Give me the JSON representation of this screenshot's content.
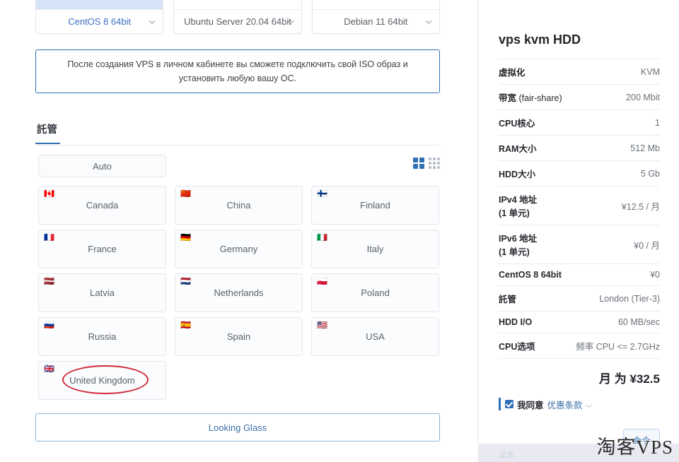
{
  "os_cards": [
    {
      "name": "CentOS 8 64bit",
      "selected": true,
      "caret": "chevron-down-icon"
    },
    {
      "name": "Ubuntu Server 20.04 64bit",
      "selected": false,
      "caret": "chevron-down-icon"
    },
    {
      "name": "Debian 11 64bit",
      "selected": false,
      "caret": "chevron-down-icon"
    }
  ],
  "info_banner": {
    "text": "После создания VPS в личном кабинете вы сможете подключить свой ISO образ и установить любую вашу ОС."
  },
  "section": {
    "tab_label": "託管",
    "auto_label": "Auto",
    "view_grid_2_icon": "grid-2x2-icon",
    "view_grid_3_icon": "grid-3x3-icon"
  },
  "countries": [
    {
      "label": "Canada",
      "flag": "🇨🇦"
    },
    {
      "label": "China",
      "flag": "🇨🇳"
    },
    {
      "label": "Finland",
      "flag": "🇫🇮"
    },
    {
      "label": "France",
      "flag": "🇫🇷"
    },
    {
      "label": "Germany",
      "flag": "🇩🇪"
    },
    {
      "label": "Italy",
      "flag": "🇮🇹"
    },
    {
      "label": "Latvia",
      "flag": "🇱🇻"
    },
    {
      "label": "Netherlands",
      "flag": "🇳🇱"
    },
    {
      "label": "Poland",
      "flag": "🇵🇱"
    },
    {
      "label": "Russia",
      "flag": "🇷🇺"
    },
    {
      "label": "Spain",
      "flag": "🇪🇸"
    },
    {
      "label": "USA",
      "flag": "🇺🇸"
    },
    {
      "label": "United Kingdom",
      "flag": "🇬🇧"
    }
  ],
  "annotation": {
    "target": "United Kingdom",
    "color": "#cf2a36",
    "shape": "ellipse"
  },
  "looking_glass_label": "Looking Glass",
  "panel": {
    "title": "vps kvm HDD",
    "specs": [
      {
        "key": "虚拟化",
        "key2": "",
        "value": "KVM"
      },
      {
        "key": "带宽",
        "key_sub": " (fair-share)",
        "key2": "",
        "value": "200 Mbit"
      },
      {
        "key": "CPU核心",
        "key2": "",
        "value": "1"
      },
      {
        "key": "RAM大小",
        "key2": "",
        "value": "512 Mb"
      },
      {
        "key": "HDD大小",
        "key2": "",
        "value": "5 Gb"
      },
      {
        "key": "IPv4 地址",
        "key2": "(1 单元)",
        "value": "¥12.5 / 月"
      },
      {
        "key": "IPv6 地址",
        "key2": "(1 单元)",
        "value": "¥0 / 月"
      },
      {
        "key": "CentOS 8 64bit",
        "key2": "",
        "value": "¥0"
      },
      {
        "key": "託管",
        "key2": "",
        "value": "London (Tier-3)"
      },
      {
        "key": "HDD I/O",
        "key2": "",
        "value": "60 MB/sec"
      },
      {
        "key": "CPU选项",
        "key2": "",
        "value": "频率 CPU <= 2.7GHz"
      }
    ],
    "total_price": "月 为 ¥32.5",
    "terms": {
      "checked": true,
      "agree_label": "我同意",
      "link_label": "优惠条款",
      "external_icon": "external-link-icon"
    },
    "command_button": "命令",
    "footer_text": "源表"
  },
  "watermark": "淘客VPS",
  "colors": {
    "accent": "#2f6fb5",
    "selected_card_top": "#d7e4f8",
    "annotation_red": "#cf2a36",
    "link": "#3a6ea8"
  }
}
